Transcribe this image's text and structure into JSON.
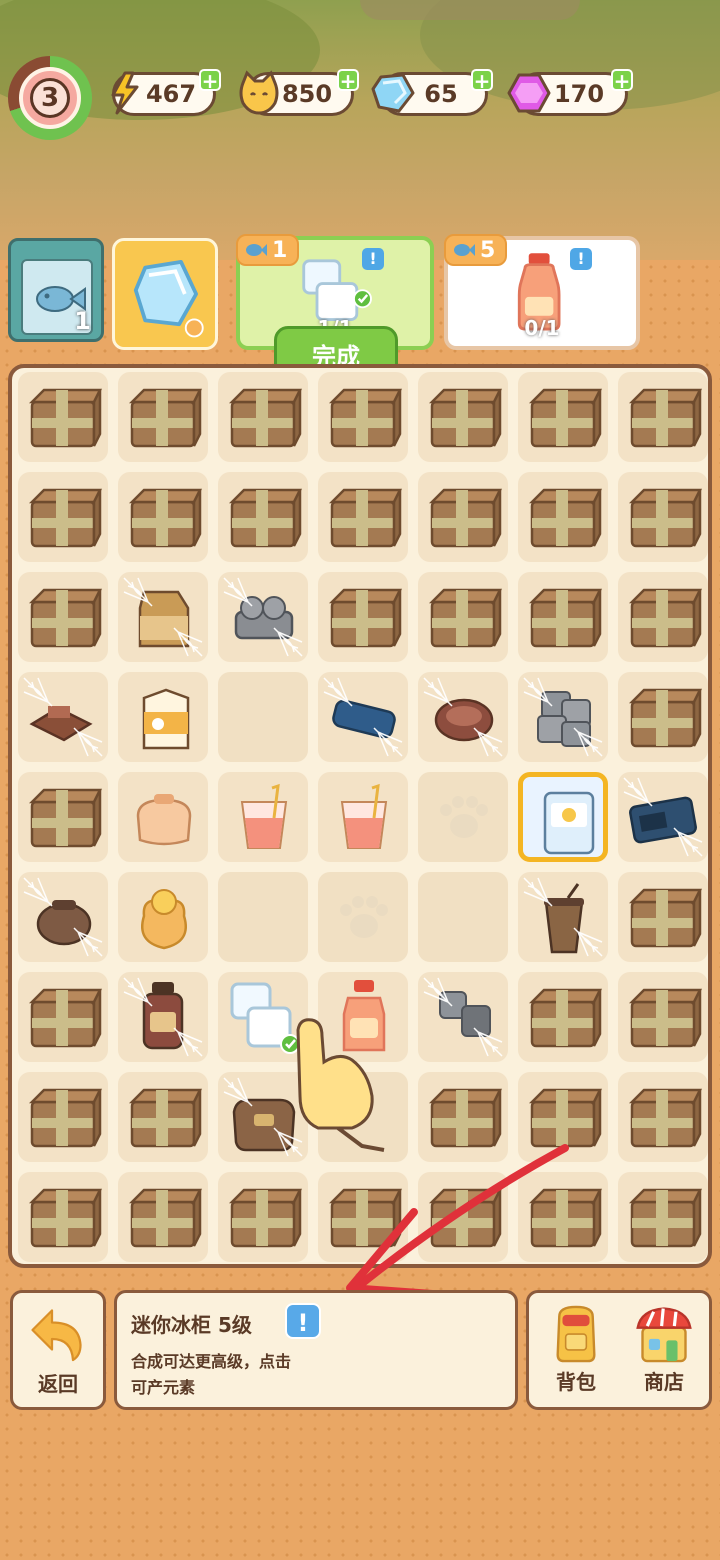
{
  "status": {
    "level": "3",
    "resources": [
      {
        "name": "energy",
        "icon": "lightning-icon",
        "value": "467"
      },
      {
        "name": "cat-coin",
        "icon": "cat-coin-icon",
        "value": "850"
      },
      {
        "name": "diamond",
        "icon": "diamond-icon",
        "value": "65"
      },
      {
        "name": "gem",
        "icon": "purple-gem-icon",
        "value": "170"
      }
    ],
    "plus_label": "+"
  },
  "orders": {
    "calendar_count": "1",
    "cards": [
      {
        "reward": "1",
        "progress": "1/1",
        "state": "complete",
        "item": "ice-cubes"
      },
      {
        "reward": "5",
        "progress": "0/1",
        "state": "pending",
        "item": "juice-bottle"
      }
    ],
    "info_mark": "!",
    "complete_label": "完成"
  },
  "board": {
    "selected_item": "mini-fridge"
  },
  "info_panel": {
    "title": "迷你冰柜",
    "level": "5级",
    "description_line1": "合成可达更高级，点击",
    "description_line2": "可产元素",
    "icon": "!"
  },
  "bottom": {
    "back_label": "返回",
    "bag_label": "背包",
    "shop_label": "商店"
  }
}
